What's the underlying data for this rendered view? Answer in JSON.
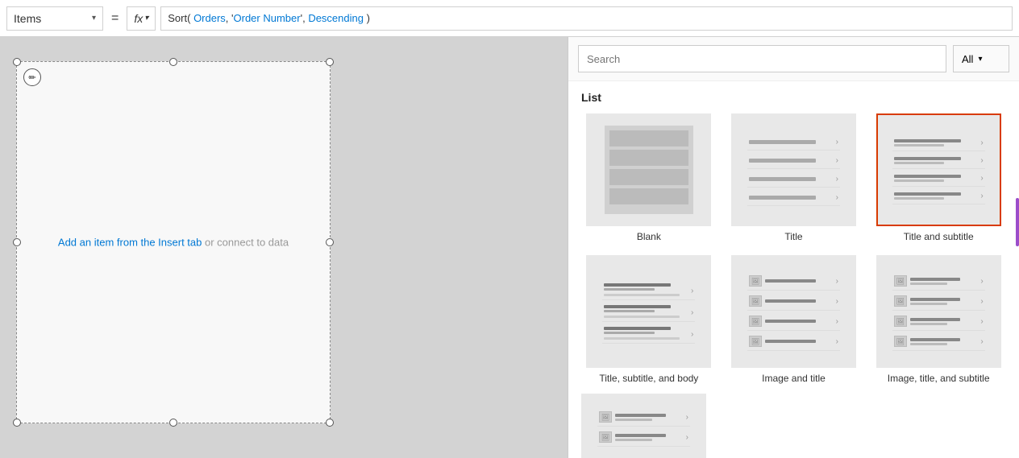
{
  "toolbar": {
    "items_label": "Items",
    "equals": "=",
    "fx_label": "fx",
    "formula": "Sort( Orders, 'Order Number', Descending )",
    "formula_parts": {
      "prefix": "Sort( ",
      "arg1": "Orders",
      "sep1": ", '",
      "arg2": "Order Number",
      "sep2": "', ",
      "arg3": "Descending",
      "suffix": " )"
    }
  },
  "panel": {
    "search_placeholder": "Search",
    "all_label": "All",
    "section_list": "List",
    "templates": [
      {
        "id": "blank",
        "label": "Blank",
        "selected": false
      },
      {
        "id": "title",
        "label": "Title",
        "selected": false
      },
      {
        "id": "title-subtitle",
        "label": "Title and subtitle",
        "selected": true
      },
      {
        "id": "title-subtitle-body",
        "label": "Title, subtitle, and body",
        "selected": false
      },
      {
        "id": "image-title",
        "label": "Image and title",
        "selected": false
      },
      {
        "id": "image-title-subtitle",
        "label": "Image, title, and subtitle",
        "selected": false
      }
    ]
  },
  "canvas": {
    "hint_text": "Add an item from the Insert tab",
    "hint_link": "or connect to data"
  }
}
